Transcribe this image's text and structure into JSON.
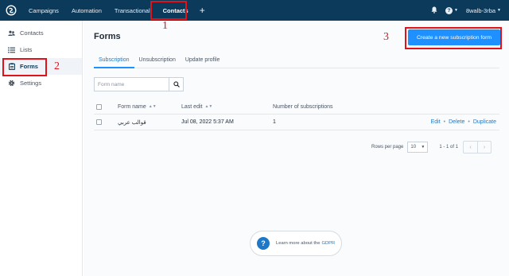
{
  "topbar": {
    "nav": [
      "Campaigns",
      "Automation",
      "Transactional",
      "Contacts"
    ],
    "plus": "+",
    "user": "8walb-3rba"
  },
  "sidebar": {
    "items": [
      {
        "label": "Contacts",
        "icon": "people-icon"
      },
      {
        "label": "Lists",
        "icon": "list-icon"
      },
      {
        "label": "Forms",
        "icon": "clipboard-icon"
      },
      {
        "label": "Settings",
        "icon": "gear-icon"
      }
    ]
  },
  "main": {
    "title": "Forms",
    "create_button": "Create a new subscription form",
    "tabs": [
      "Subscription",
      "Unsubscription",
      "Update profile"
    ],
    "search": {
      "placeholder": "Form name"
    },
    "table": {
      "headers": {
        "name": "Form name",
        "last_edit": "Last edit",
        "count": "Number of subscriptions"
      },
      "rows": [
        {
          "name": "قوالب عربي",
          "last_edit": "Jul 08, 2022 5:37 AM",
          "count": "1"
        }
      ],
      "actions": [
        "Edit",
        "Delete",
        "Duplicate"
      ]
    },
    "pager": {
      "rows_label": "Rows per page",
      "rows_value": "10",
      "range": "1 - 1 of 1"
    },
    "gdpr": {
      "text": "Learn more about the",
      "link": "GDPR"
    }
  },
  "annotations": [
    "1",
    "2",
    "3"
  ],
  "colors": {
    "topbar": "#0b3a5b",
    "accent": "#1e90ff",
    "annotation": "#e0131b"
  }
}
